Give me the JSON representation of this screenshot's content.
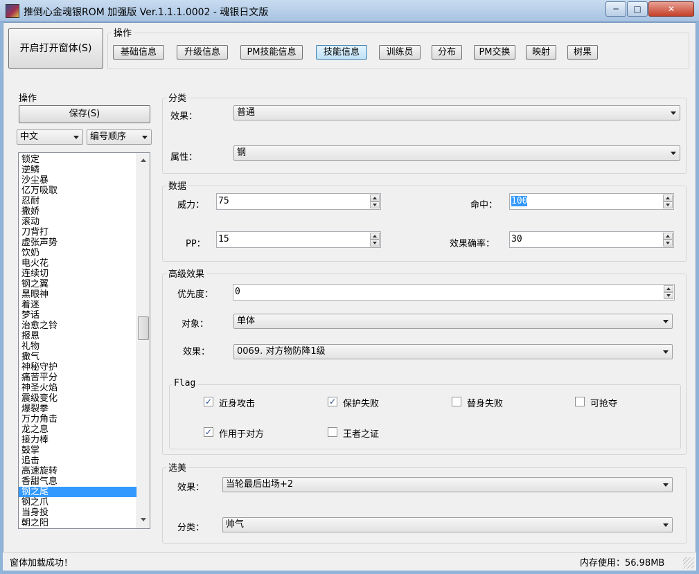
{
  "window": {
    "title": "推倒心金魂银ROM 加强版 Ver.1.1.1.0002 - 魂银日文版",
    "min_glyph": "─",
    "max_glyph": "□",
    "close_glyph": "✕"
  },
  "top": {
    "open_window_button": "开启打开窗体(S)",
    "ops_label": "操作",
    "tabs": [
      {
        "label": "基础信息",
        "active": false
      },
      {
        "label": "升级信息",
        "active": false
      },
      {
        "label": "PM技能信息",
        "active": false
      },
      {
        "label": "技能信息",
        "active": true
      },
      {
        "label": "训练员",
        "active": false
      },
      {
        "label": "分布",
        "active": false
      },
      {
        "label": "PM交换",
        "active": false
      },
      {
        "label": "映射",
        "active": false
      },
      {
        "label": "树果",
        "active": false
      }
    ]
  },
  "left": {
    "ops_label": "操作",
    "save_button": "保存(S)",
    "language_combo": "中文",
    "order_combo": "编号顺序",
    "list_items": [
      "锁定",
      "逆鳞",
      "沙尘暴",
      "亿万吸取",
      "忍耐",
      "撒娇",
      "滚动",
      "刀背打",
      "虚张声势",
      "饮奶",
      "电火花",
      "连续切",
      "钢之翼",
      "黑眼神",
      "着迷",
      "梦话",
      "治愈之铃",
      "报恩",
      "礼物",
      "撒气",
      "神秘守护",
      "痛苦平分",
      "神圣火焰",
      "震级变化",
      "爆裂拳",
      "万力角击",
      "龙之息",
      "接力棒",
      "鼓掌",
      "追击",
      "高速旋转",
      "香甜气息",
      "钢之尾",
      "钢之爪",
      "当身投",
      "朝之阳"
    ],
    "selected_index": 32
  },
  "category": {
    "label": "分类",
    "effect_label": "效果：",
    "effect_value": "普通",
    "attr_label": "属性：",
    "attr_value": "钢"
  },
  "data_section": {
    "label": "数据",
    "power_label": "威力：",
    "power_value": "75",
    "accuracy_label": "命中：",
    "accuracy_value": "100",
    "pp_label": "PP：",
    "pp_value": "15",
    "effect_rate_label": "效果确率：",
    "effect_rate_value": "30"
  },
  "advanced": {
    "label": "高级效果",
    "priority_label": "优先度：",
    "priority_value": "0",
    "target_label": "对象：",
    "target_value": "单体",
    "effect_label": "效果：",
    "effect_value": "0069. 对方物防降1级"
  },
  "flags": {
    "label": "Flag",
    "items": [
      {
        "label": "近身攻击",
        "checked": true
      },
      {
        "label": "保护失败",
        "checked": true
      },
      {
        "label": "替身失败",
        "checked": false
      },
      {
        "label": "可抢夺",
        "checked": false
      },
      {
        "label": "作用于对方",
        "checked": true
      },
      {
        "label": "王者之证",
        "checked": false
      }
    ]
  },
  "contest": {
    "label": "选美",
    "effect_label": "效果：",
    "effect_value": "当轮最后出场+2",
    "category_label": "分类：",
    "category_value": "帅气"
  },
  "status": {
    "message": "窗体加载成功！",
    "memory": "内存使用：56.98MB"
  }
}
